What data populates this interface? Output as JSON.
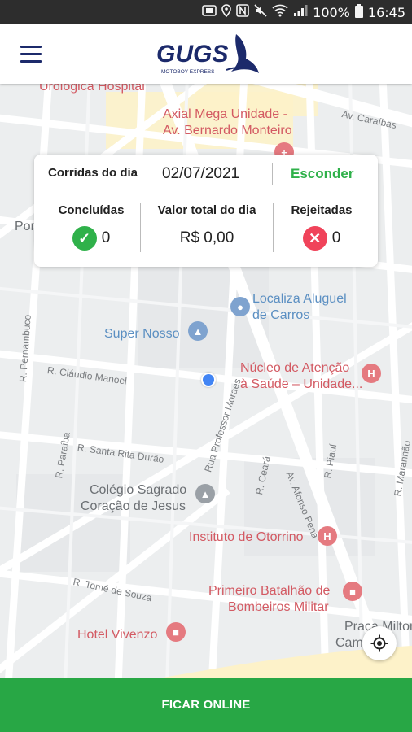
{
  "status_bar": {
    "battery": "100%",
    "time": "16:45",
    "icons": [
      "nfc-icon",
      "location-icon",
      "n-icon",
      "mute-icon",
      "wifi-icon",
      "signal-icon",
      "battery-icon"
    ]
  },
  "app_bar": {
    "logo_text": "GUGS",
    "logo_subtitle": "MOTOBOY EXPRESS",
    "menu_icon": "hamburger-menu-icon",
    "brand_color": "#1c2a6b"
  },
  "map": {
    "pois": [
      {
        "id": "urologica",
        "text": "Urológica Hospital",
        "color": "red"
      },
      {
        "id": "axial1",
        "text": "Axial Mega Unidade -",
        "color": "red"
      },
      {
        "id": "axial2",
        "text": "Av. Bernardo Monteiro",
        "color": "red"
      },
      {
        "id": "localiza1",
        "text": "Localiza Aluguel",
        "color": "blue"
      },
      {
        "id": "localiza2",
        "text": "de Carros",
        "color": "blue"
      },
      {
        "id": "supernosso",
        "text": "Super Nosso",
        "color": "blue"
      },
      {
        "id": "nucleo1",
        "text": "Núcleo de Atenção",
        "color": "red"
      },
      {
        "id": "nucleo2",
        "text": "à Saúde – Unidade...",
        "color": "red"
      },
      {
        "id": "colegio1",
        "text": "Colégio Sagrado",
        "color": "gray"
      },
      {
        "id": "colegio2",
        "text": "Coração de Jesus",
        "color": "gray"
      },
      {
        "id": "otorrino",
        "text": "Instituto de Otorrino",
        "color": "red"
      },
      {
        "id": "batalhao1",
        "text": "Primeiro Batalhão de",
        "color": "red"
      },
      {
        "id": "batalhao2",
        "text": "Bombeiros Militar",
        "color": "red"
      },
      {
        "id": "vivenzo",
        "text": "Hotel Vivenzo",
        "color": "red"
      },
      {
        "id": "praca1",
        "text": "Praça Milton",
        "color": "gray"
      },
      {
        "id": "praca2",
        "text": "Cam",
        "color": "gray"
      },
      {
        "id": "por",
        "text": "Por",
        "color": "gray"
      }
    ],
    "streets": [
      {
        "id": "caraibas",
        "text": "Av. Caraíbas"
      },
      {
        "id": "pernambuco",
        "text": "R. Pernambuco"
      },
      {
        "id": "claudio",
        "text": "R. Cláudio Manoel"
      },
      {
        "id": "professor",
        "text": "Rua Professor Moraes"
      },
      {
        "id": "santarita",
        "text": "R. Santa Rita Durão"
      },
      {
        "id": "paraiba",
        "text": "R. Paraíba"
      },
      {
        "id": "ceara",
        "text": "R. Ceará"
      },
      {
        "id": "afonso",
        "text": "Av. Afonso Pena"
      },
      {
        "id": "piaui",
        "text": "R. Piauí"
      },
      {
        "id": "maranhao",
        "text": "R. Maranhão"
      },
      {
        "id": "tome",
        "text": "R. Tomé de Souza"
      }
    ]
  },
  "summary_card": {
    "day_label": "Corridas do dia",
    "date": "02/07/2021",
    "hide_label": "Esconder",
    "completed_label": "Concluídas",
    "completed_count": "0",
    "total_label": "Valor total do dia",
    "total_value": "R$ 0,00",
    "rejected_label": "Rejeitadas",
    "rejected_count": "0",
    "colors": {
      "green": "#2fb14a",
      "red": "#f0435a"
    }
  },
  "gps_button": {
    "icon": "my-location-icon"
  },
  "bottom_button": {
    "label": "FICAR ONLINE",
    "color": "#28a745"
  }
}
